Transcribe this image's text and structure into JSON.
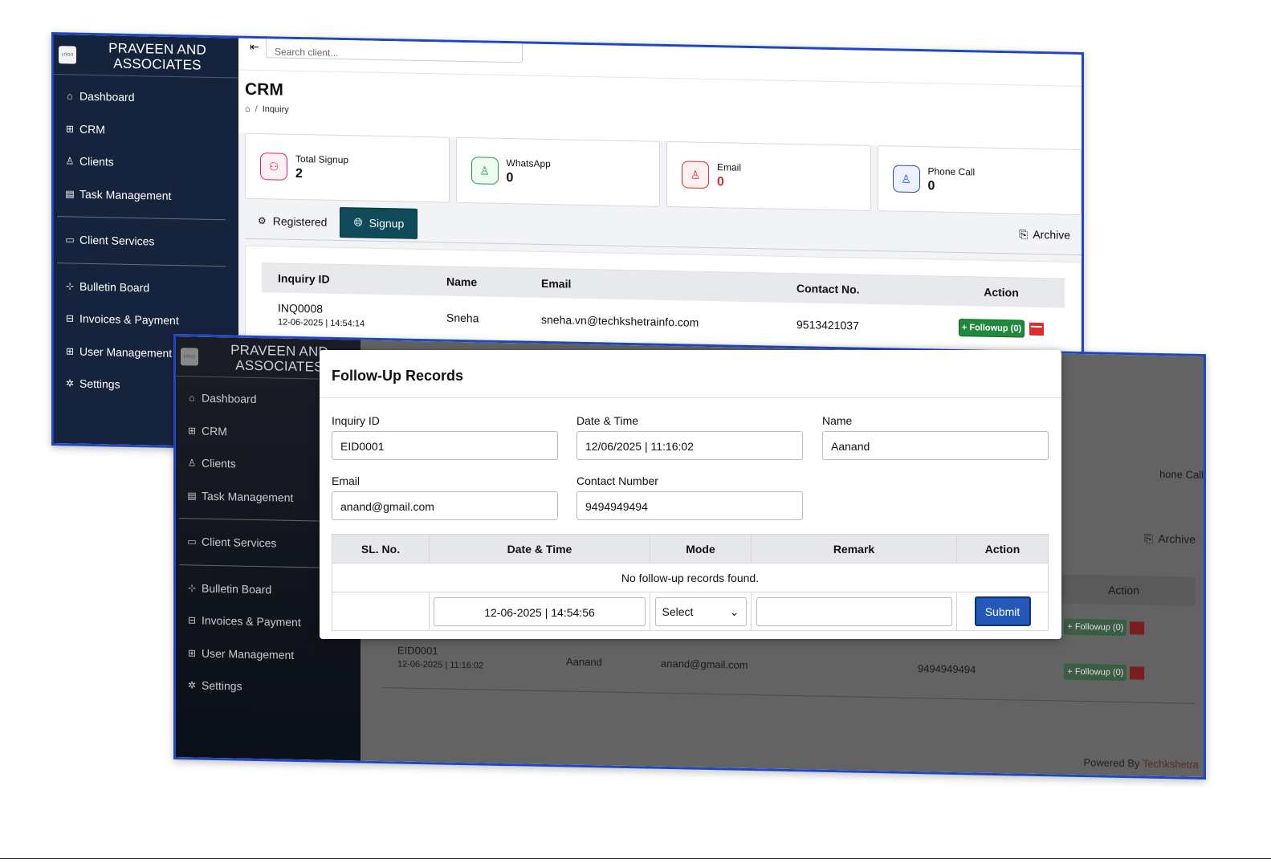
{
  "brand": {
    "line1": "PRAVEEN AND",
    "line2": "ASSOCIATES",
    "logo_text": "LOGO"
  },
  "nav": {
    "dashboard": "Dashboard",
    "crm": "CRM",
    "clients": "Clients",
    "tasks": "Task Management",
    "client_services": "Client Services",
    "bulletin": "Bulletin Board",
    "invoices": "Invoices & Payment",
    "users": "User Management",
    "settings": "Settings"
  },
  "topbar": {
    "search_placeholder": "Search client..."
  },
  "page": {
    "title": "CRM",
    "breadcrumb": "Inquiry"
  },
  "stats": [
    {
      "label": "Total Signup",
      "value": "2",
      "color": "#e0245e"
    },
    {
      "label": "WhatsApp",
      "value": "0",
      "color": "#1e9e45"
    },
    {
      "label": "Email",
      "value": "0",
      "color": "#d32f2f"
    },
    {
      "label": "Phone Call",
      "value": "0",
      "color": "#2747c9"
    }
  ],
  "tabs": {
    "registered": "Registered",
    "signup": "Signup",
    "archive": "Archive"
  },
  "table": {
    "headers": [
      "Inquiry ID",
      "Name",
      "Email",
      "Contact No.",
      "Action"
    ],
    "rows": [
      {
        "id": "INQ0008",
        "date": "12-06-2025 | 14:54:14",
        "name": "Sneha",
        "email": "sneha.vn@techkshetrainfo.com",
        "contact": "9513421037",
        "followup": "+ Followup (0)"
      },
      {
        "id": "EID0001",
        "date": "12-06-2025 | 11:16:02",
        "name": "Aanand",
        "email": "anand@gmail.com",
        "contact": "9494949494",
        "followup": "+ Followup (0)"
      }
    ]
  },
  "bg": {
    "phone_call_partial": "hone Call",
    "archive": "Archive",
    "action": "Action",
    "powered_prefix": "Powered By ",
    "powered_brand": "Techkshetra"
  },
  "modal": {
    "title": "Follow-Up Records",
    "fields": {
      "inquiry_id_label": "Inquiry ID",
      "inquiry_id": "EID0001",
      "datetime_label": "Date & Time",
      "datetime": "12/06/2025 | 11:16:02",
      "name_label": "Name",
      "name": "Aanand",
      "email_label": "Email",
      "email": "anand@gmail.com",
      "contact_label": "Contact Number",
      "contact": "9494949494"
    },
    "table_headers": [
      "SL. No.",
      "Date & Time",
      "Mode",
      "Remark",
      "Action"
    ],
    "empty_text": "No follow-up records found.",
    "new_datetime": "12-06-2025 | 14:54:56",
    "mode_select": "Select",
    "submit": "Submit"
  }
}
